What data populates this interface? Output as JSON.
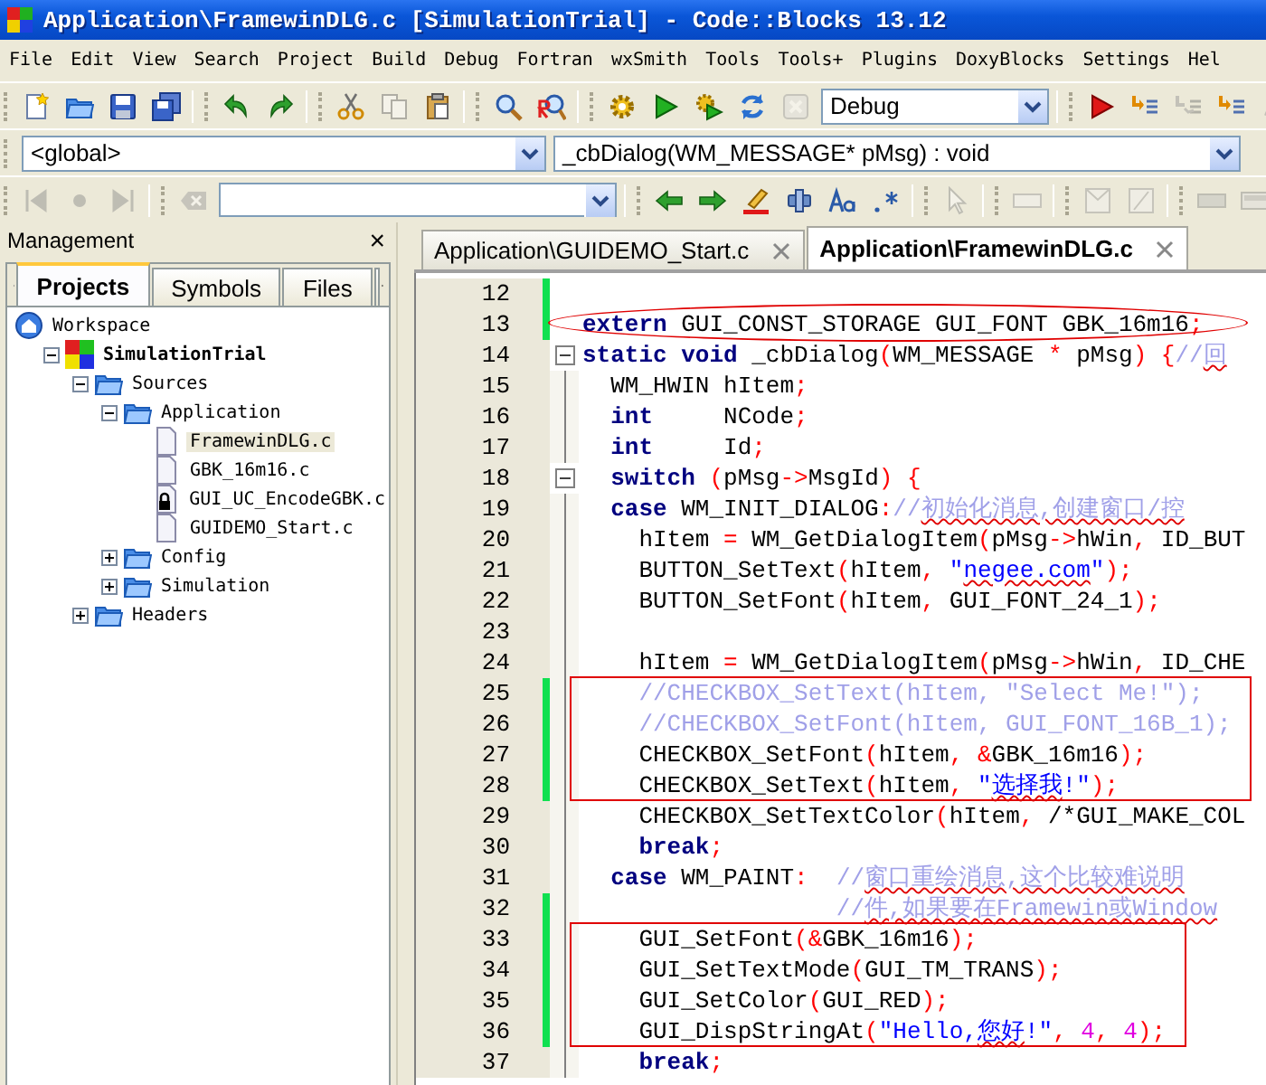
{
  "window": {
    "title": "Application\\FramewinDLG.c [SimulationTrial] - Code::Blocks 13.12"
  },
  "menu": [
    "File",
    "Edit",
    "View",
    "Search",
    "Project",
    "Build",
    "Debug",
    "Fortran",
    "wxSmith",
    "Tools",
    "Tools+",
    "Plugins",
    "DoxyBlocks",
    "Settings",
    "Hel"
  ],
  "toolbar_1": [
    {
      "kind": "button",
      "disabled": false
    },
    {
      "kind": "button",
      "disabled": false
    },
    {
      "kind": "button",
      "disabled": false
    },
    {
      "kind": "button",
      "disabled": false
    },
    {
      "kind": "separator"
    },
    {
      "kind": "button",
      "disabled": false
    },
    {
      "kind": "button",
      "disabled": false
    },
    {
      "kind": "separator"
    },
    {
      "kind": "button",
      "disabled": false
    },
    {
      "kind": "button",
      "disabled": true
    },
    {
      "kind": "button",
      "disabled": false
    },
    {
      "kind": "separator"
    },
    {
      "kind": "button",
      "disabled": false
    },
    {
      "kind": "button",
      "disabled": false
    },
    {
      "kind": "separator"
    },
    {
      "kind": "button",
      "disabled": false
    },
    {
      "kind": "button",
      "disabled": false
    },
    {
      "kind": "button",
      "disabled": false
    },
    {
      "kind": "button",
      "disabled": false
    },
    {
      "kind": "button",
      "disabled": true
    },
    {
      "kind": "combo",
      "value": "Debug"
    },
    {
      "kind": "separator"
    },
    {
      "kind": "button",
      "disabled": false
    },
    {
      "kind": "button",
      "disabled": false
    },
    {
      "kind": "button",
      "disabled": true
    },
    {
      "kind": "button",
      "disabled": false
    },
    {
      "kind": "button",
      "disabled": true
    }
  ],
  "toolbar_2": [
    {
      "kind": "combo",
      "value": "<global>"
    },
    {
      "kind": "combo",
      "value": "_cbDialog(WM_MESSAGE* pMsg) : void"
    }
  ],
  "toolbar_3": [
    {
      "kind": "button",
      "disabled": true
    },
    {
      "kind": "button",
      "disabled": true
    },
    {
      "kind": "button",
      "disabled": true
    },
    {
      "kind": "separator"
    },
    {
      "kind": "button",
      "disabled": true
    },
    {
      "kind": "combo"
    },
    {
      "kind": "separator"
    },
    {
      "kind": "button",
      "disabled": false
    },
    {
      "kind": "button",
      "disabled": false
    },
    {
      "kind": "button",
      "disabled": false
    },
    {
      "kind": "button",
      "disabled": false
    },
    {
      "kind": "button",
      "disabled": false
    },
    {
      "kind": "button",
      "disabled": false
    },
    {
      "kind": "separator"
    },
    {
      "kind": "button",
      "disabled": true
    },
    {
      "kind": "separator"
    },
    {
      "kind": "button",
      "disabled": true
    },
    {
      "kind": "separator"
    },
    {
      "kind": "button",
      "disabled": true
    },
    {
      "kind": "button",
      "disabled": true
    },
    {
      "kind": "separator"
    },
    {
      "kind": "button",
      "disabled": true
    },
    {
      "kind": "button",
      "disabled": true
    }
  ],
  "management": {
    "title": "Management",
    "close": "×",
    "tabs": [
      {
        "label": "Projects",
        "selected": true
      },
      {
        "label": "Symbols",
        "selected": false
      },
      {
        "label": "Files",
        "selected": false
      }
    ],
    "tree": [
      {
        "label": "Workspace",
        "kind": "workspace",
        "children": [
          {
            "label": "SimulationTrial",
            "kind": "project",
            "expanded": true,
            "children": [
              {
                "label": "Sources",
                "kind": "folder",
                "expanded": true,
                "children": [
                  {
                    "label": "Application",
                    "kind": "folder",
                    "expanded": true,
                    "children": [
                      {
                        "label": "FramewinDLG.c",
                        "kind": "file",
                        "selected": true,
                        "locked": false
                      },
                      {
                        "label": "GBK_16m16.c",
                        "kind": "file",
                        "selected": false,
                        "locked": false
                      },
                      {
                        "label": "GUI_UC_EncodeGBK.c",
                        "kind": "file",
                        "selected": false,
                        "locked": true
                      },
                      {
                        "label": "GUIDEMO_Start.c",
                        "kind": "file",
                        "selected": false,
                        "locked": false
                      }
                    ]
                  },
                  {
                    "label": "Config",
                    "kind": "folder",
                    "expanded": false
                  },
                  {
                    "label": "Simulation",
                    "kind": "folder",
                    "expanded": false
                  }
                ]
              },
              {
                "label": "Headers",
                "kind": "folder",
                "expanded": false
              }
            ]
          }
        ]
      }
    ]
  },
  "editor_tabs": [
    {
      "label": "Application\\GUIDEMO_Start.c",
      "selected": false
    },
    {
      "label": "Application\\FramewinDLG.c",
      "selected": true
    }
  ],
  "code_lines": [
    {
      "number": "12",
      "changed": true,
      "circled": false,
      "boxed": false
    },
    {
      "number": "13",
      "changed": true,
      "circled": true,
      "boxed": false,
      "segments": [
        {
          "kind": "kw",
          "text": "extern"
        },
        {
          "kind": "plain",
          "text": " GUI_CONST_STORAGE GUI_FONT GBK_16m16"
        },
        {
          "kind": "op",
          "text": ";"
        }
      ]
    },
    {
      "number": "14",
      "changed": false,
      "circled": false,
      "boxed": false,
      "fold_expanded": true,
      "segments": [
        {
          "kind": "kw",
          "text": "static"
        },
        {
          "kind": "kw",
          "text": " void"
        },
        {
          "kind": "plain",
          "text": " _cbDialog"
        },
        {
          "kind": "op",
          "text": "("
        },
        {
          "kind": "plain",
          "text": "WM_MESSAGE "
        },
        {
          "kind": "op",
          "text": "*"
        },
        {
          "kind": "plain",
          "text": " pMsg"
        },
        {
          "kind": "op",
          "text": ") {"
        },
        {
          "kind": "cmt",
          "text": "//"
        },
        {
          "kind": "cmt",
          "text": "回",
          "misspelled": true
        }
      ]
    },
    {
      "number": "15",
      "changed": false,
      "circled": false,
      "boxed": false,
      "segments": [
        {
          "kind": "plain",
          "text": "  WM_HWIN hItem"
        },
        {
          "kind": "op",
          "text": ";"
        }
      ]
    },
    {
      "number": "16",
      "changed": false,
      "circled": false,
      "boxed": false,
      "segments": [
        {
          "kind": "kw",
          "text": "  int"
        },
        {
          "kind": "plain",
          "text": "     NCode"
        },
        {
          "kind": "op",
          "text": ";"
        }
      ]
    },
    {
      "number": "17",
      "changed": false,
      "circled": false,
      "boxed": false,
      "segments": [
        {
          "kind": "kw",
          "text": "  int"
        },
        {
          "kind": "plain",
          "text": "     Id"
        },
        {
          "kind": "op",
          "text": ";"
        }
      ]
    },
    {
      "number": "18",
      "changed": false,
      "circled": false,
      "boxed": false,
      "fold_expanded": true,
      "segments": [
        {
          "kind": "kw",
          "text": "  switch"
        },
        {
          "kind": "op",
          "text": " ("
        },
        {
          "kind": "plain",
          "text": "pMsg"
        },
        {
          "kind": "op",
          "text": "->"
        },
        {
          "kind": "plain",
          "text": "MsgId"
        },
        {
          "kind": "op",
          "text": ") {"
        }
      ]
    },
    {
      "number": "19",
      "changed": false,
      "circled": false,
      "boxed": false,
      "segments": [
        {
          "kind": "kw",
          "text": "  case"
        },
        {
          "kind": "plain",
          "text": " WM_INIT_DIALOG"
        },
        {
          "kind": "op",
          "text": ":"
        },
        {
          "kind": "cmt",
          "text": "//"
        },
        {
          "kind": "cmt",
          "text": "初始化消息,创建窗口/控",
          "misspelled": true
        }
      ]
    },
    {
      "number": "20",
      "changed": false,
      "circled": false,
      "boxed": false,
      "segments": [
        {
          "kind": "plain",
          "text": "    hItem "
        },
        {
          "kind": "op",
          "text": "="
        },
        {
          "kind": "plain",
          "text": " WM_GetDialogItem"
        },
        {
          "kind": "op",
          "text": "("
        },
        {
          "kind": "plain",
          "text": "pMsg"
        },
        {
          "kind": "op",
          "text": "->"
        },
        {
          "kind": "plain",
          "text": "hWin"
        },
        {
          "kind": "op",
          "text": ","
        },
        {
          "kind": "plain",
          "text": " ID_BUT"
        }
      ]
    },
    {
      "number": "21",
      "changed": false,
      "circled": false,
      "boxed": false,
      "segments": [
        {
          "kind": "plain",
          "text": "    BUTTON_SetText"
        },
        {
          "kind": "op",
          "text": "("
        },
        {
          "kind": "plain",
          "text": "hItem"
        },
        {
          "kind": "op",
          "text": ","
        },
        {
          "kind": "str",
          "text": " \""
        },
        {
          "kind": "str",
          "text": "negee.com",
          "misspelled": true
        },
        {
          "kind": "str",
          "text": "\""
        },
        {
          "kind": "op",
          "text": ");"
        }
      ]
    },
    {
      "number": "22",
      "changed": false,
      "circled": false,
      "boxed": false,
      "segments": [
        {
          "kind": "plain",
          "text": "    BUTTON_SetFont"
        },
        {
          "kind": "op",
          "text": "("
        },
        {
          "kind": "plain",
          "text": "hItem"
        },
        {
          "kind": "op",
          "text": ","
        },
        {
          "kind": "plain",
          "text": " GUI_FONT_24_1"
        },
        {
          "kind": "op",
          "text": ");"
        }
      ]
    },
    {
      "number": "23",
      "changed": false,
      "circled": false,
      "boxed": false
    },
    {
      "number": "24",
      "changed": false,
      "circled": false,
      "boxed": false,
      "segments": [
        {
          "kind": "plain",
          "text": "    hItem "
        },
        {
          "kind": "op",
          "text": "="
        },
        {
          "kind": "plain",
          "text": " WM_GetDialogItem"
        },
        {
          "kind": "op",
          "text": "("
        },
        {
          "kind": "plain",
          "text": "pMsg"
        },
        {
          "kind": "op",
          "text": "->"
        },
        {
          "kind": "plain",
          "text": "hWin"
        },
        {
          "kind": "op",
          "text": ","
        },
        {
          "kind": "plain",
          "text": " ID_CHE"
        }
      ]
    },
    {
      "number": "25",
      "changed": true,
      "circled": false,
      "boxed": true,
      "segments": [
        {
          "kind": "cmt",
          "text": "    //CHECKBOX_SetText(hItem, \"Select Me!\");"
        }
      ]
    },
    {
      "number": "26",
      "changed": true,
      "circled": false,
      "boxed": true,
      "segments": [
        {
          "kind": "cmt",
          "text": "    //CHECKBOX_SetFont(hItem, GUI_FONT_16B_1);"
        }
      ]
    },
    {
      "number": "27",
      "changed": true,
      "circled": false,
      "boxed": true,
      "segments": [
        {
          "kind": "plain",
          "text": "    CHECKBOX_SetFont"
        },
        {
          "kind": "op",
          "text": "("
        },
        {
          "kind": "plain",
          "text": "hItem"
        },
        {
          "kind": "op",
          "text": ", &"
        },
        {
          "kind": "plain",
          "text": "GBK_16m16"
        },
        {
          "kind": "op",
          "text": ");"
        }
      ]
    },
    {
      "number": "28",
      "changed": true,
      "circled": false,
      "boxed": true,
      "segments": [
        {
          "kind": "plain",
          "text": "    CHECKBOX_SetText"
        },
        {
          "kind": "op",
          "text": "("
        },
        {
          "kind": "plain",
          "text": "hItem"
        },
        {
          "kind": "op",
          "text": ","
        },
        {
          "kind": "str",
          "text": " \""
        },
        {
          "kind": "str",
          "text": "选择我",
          "misspelled": true
        },
        {
          "kind": "str",
          "text": "!\""
        },
        {
          "kind": "op",
          "text": ");"
        }
      ]
    },
    {
      "number": "29",
      "changed": false,
      "circled": false,
      "boxed": false,
      "segments": [
        {
          "kind": "plain",
          "text": "    CHECKBOX_SetTextColor"
        },
        {
          "kind": "op",
          "text": "("
        },
        {
          "kind": "plain",
          "text": "hItem"
        },
        {
          "kind": "op",
          "text": ","
        },
        {
          "kind": "plain",
          "text": " /*GUI_MAKE_COL"
        }
      ]
    },
    {
      "number": "30",
      "changed": false,
      "circled": false,
      "boxed": false,
      "segments": [
        {
          "kind": "kw",
          "text": "    break"
        },
        {
          "kind": "op",
          "text": ";"
        }
      ]
    },
    {
      "number": "31",
      "changed": false,
      "circled": false,
      "boxed": false,
      "segments": [
        {
          "kind": "kw",
          "text": "  case"
        },
        {
          "kind": "plain",
          "text": " WM_PAINT"
        },
        {
          "kind": "op",
          "text": ":"
        },
        {
          "kind": "cmt",
          "text": "  //"
        },
        {
          "kind": "cmt",
          "text": "窗口重绘消息,这个比较难说明",
          "misspelled": true
        }
      ]
    },
    {
      "number": "32",
      "changed": true,
      "circled": false,
      "boxed": false,
      "segments": [
        {
          "kind": "cmt",
          "text": "                  //"
        },
        {
          "kind": "cmt",
          "text": "件,如果要在Framewin或Window",
          "misspelled": true
        }
      ]
    },
    {
      "number": "33",
      "changed": true,
      "circled": false,
      "boxed": true,
      "segments": [
        {
          "kind": "plain",
          "text": "    GUI_SetFont"
        },
        {
          "kind": "op",
          "text": "(&"
        },
        {
          "kind": "plain",
          "text": "GBK_16m16"
        },
        {
          "kind": "op",
          "text": ");"
        }
      ]
    },
    {
      "number": "34",
      "changed": true,
      "circled": false,
      "boxed": true,
      "segments": [
        {
          "kind": "plain",
          "text": "    GUI_SetTextMode"
        },
        {
          "kind": "op",
          "text": "("
        },
        {
          "kind": "plain",
          "text": "GUI_TM_TRANS"
        },
        {
          "kind": "op",
          "text": ");"
        }
      ]
    },
    {
      "number": "35",
      "changed": true,
      "circled": false,
      "boxed": true,
      "segments": [
        {
          "kind": "plain",
          "text": "    GUI_SetColor"
        },
        {
          "kind": "op",
          "text": "("
        },
        {
          "kind": "plain",
          "text": "GUI_RED"
        },
        {
          "kind": "op",
          "text": ");"
        }
      ]
    },
    {
      "number": "36",
      "changed": true,
      "circled": false,
      "boxed": true,
      "segments": [
        {
          "kind": "plain",
          "text": "    GUI_DispStringAt"
        },
        {
          "kind": "op",
          "text": "("
        },
        {
          "kind": "str",
          "text": "\"Hello,"
        },
        {
          "kind": "str",
          "text": "您好",
          "misspelled": true
        },
        {
          "kind": "str",
          "text": "!\""
        },
        {
          "kind": "op",
          "text": ","
        },
        {
          "kind": "num",
          "text": " 4"
        },
        {
          "kind": "op",
          "text": ","
        },
        {
          "kind": "num",
          "text": " 4"
        },
        {
          "kind": "op",
          "text": ");"
        }
      ]
    },
    {
      "number": "37",
      "changed": false,
      "circled": false,
      "boxed": false,
      "segments": [
        {
          "kind": "kw",
          "text": "    break"
        },
        {
          "kind": "op",
          "text": ";"
        }
      ]
    }
  ]
}
